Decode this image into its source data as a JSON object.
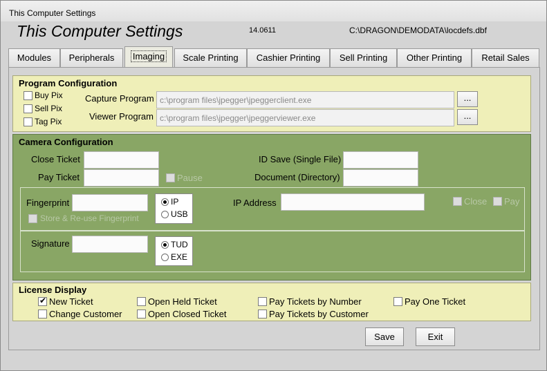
{
  "window": {
    "title": "This Computer Settings"
  },
  "header": {
    "title": "This Computer Settings",
    "version": "14.0611",
    "path": "C:\\DRAGON\\DEMODATA\\locdefs.dbf"
  },
  "tabs": [
    {
      "label": "Modules"
    },
    {
      "label": "Peripherals"
    },
    {
      "label": "Imaging",
      "active": true
    },
    {
      "label": "Scale Printing"
    },
    {
      "label": "Cashier Printing"
    },
    {
      "label": "Sell Printing"
    },
    {
      "label": "Other Printing"
    },
    {
      "label": "Retail Sales"
    }
  ],
  "program_config": {
    "title": "Program Configuration",
    "checkboxes": {
      "buy_pix": "Buy Pix",
      "sell_pix": "Sell Pix",
      "tag_pix": "Tag Pix"
    },
    "capture_label": "Capture Program",
    "capture_value": "c:\\program files\\jpegger\\jpeggerclient.exe",
    "viewer_label": "Viewer Program",
    "viewer_value": "c:\\program files\\jpegger\\jpeggerviewer.exe",
    "browse_label": "..."
  },
  "camera_config": {
    "title": "Camera Configuration",
    "close_ticket": "Close Ticket",
    "pay_ticket": "Pay Ticket",
    "pause": "Pause",
    "id_save": "ID Save (Single File)",
    "document": "Document (Directory)",
    "fingerprint": "Fingerprint",
    "store_reuse": "Store & Re-use Fingerprint",
    "ip": "IP",
    "usb": "USB",
    "ip_address": "IP Address",
    "close": "Close",
    "pay": "Pay",
    "signature": "Signature",
    "tud": "TUD",
    "exe": "EXE"
  },
  "license_display": {
    "title": "License Display",
    "new_ticket": "New Ticket",
    "change_customer": "Change Customer",
    "open_held_ticket": "Open Held Ticket",
    "open_closed_ticket": "Open Closed Ticket",
    "pay_by_number": "Pay Tickets by Number",
    "pay_by_customer": "Pay Tickets by Customer",
    "pay_one_ticket": "Pay One Ticket"
  },
  "buttons": {
    "save": "Save",
    "exit": "Exit"
  },
  "colors": {
    "yellow_panel": "#efefb8",
    "green_panel": "#89a665"
  }
}
